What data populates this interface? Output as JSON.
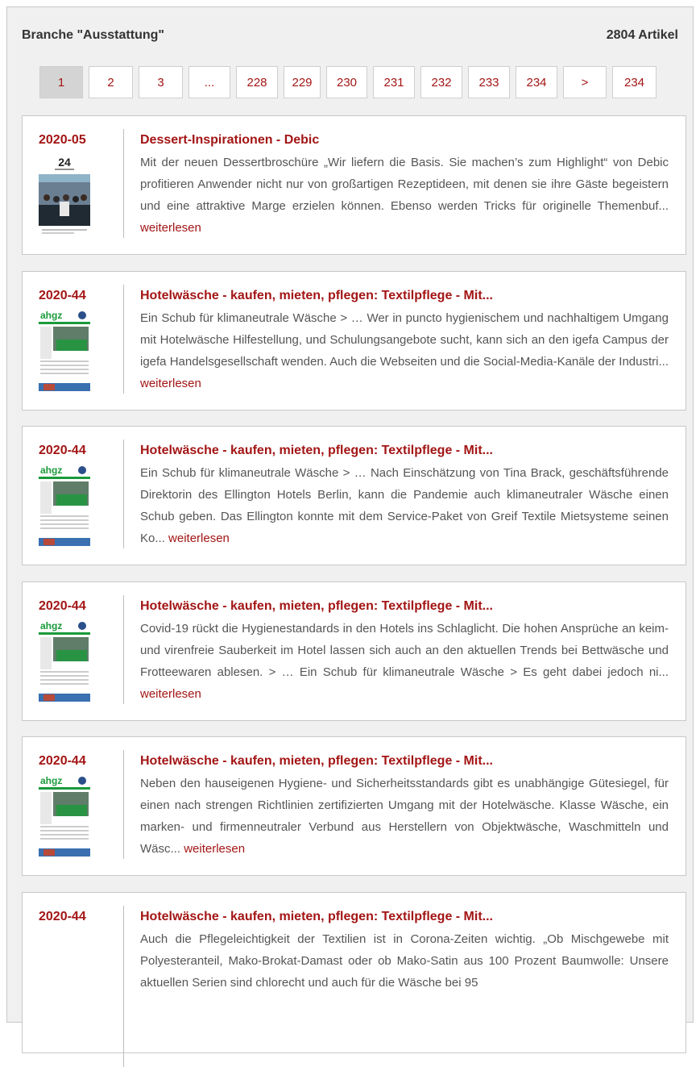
{
  "header": {
    "branche": "Branche \"Ausstattung\"",
    "count": "2804 Artikel"
  },
  "pagination": [
    {
      "label": "1",
      "active": true
    },
    {
      "label": "2"
    },
    {
      "label": "3"
    },
    {
      "label": "..."
    },
    {
      "label": "228"
    },
    {
      "label": "229"
    },
    {
      "label": "230"
    },
    {
      "label": "231"
    },
    {
      "label": "232"
    },
    {
      "label": "233"
    },
    {
      "label": "234"
    },
    {
      "label": ">"
    },
    {
      "label": "234"
    }
  ],
  "articles": [
    {
      "date": "2020-05",
      "thumb": "24",
      "title": "Dessert-Inspirationen - Debic",
      "text": "Mit der neuen Dessertbroschüre „Wir liefern die Basis. Sie machen’s zum Highlight“ von Debic profitieren Anwender nicht nur von großartigen Rezeptideen, mit denen sie ihre Gäste begeistern und eine attraktive Marge erzielen können. Ebenso werden Tricks für originelle Themenbuf...",
      "more": "weiterlesen"
    },
    {
      "date": "2020-44",
      "thumb": "ahgz",
      "title": "Hotelwäsche - kaufen, mieten, pflegen: Textilpflege - Mit...",
      "text": "Ein Schub für klimaneutrale Wäsche > … Wer in puncto hygienischem und nachhaltigem Umgang mit Hotelwäsche Hilfestellung, und Schulungsangebote sucht, kann sich an den igefa Campus der igefa Handelsgesellschaft wenden. Auch die Webseiten und die Social-Media-Kanäle der Industri...",
      "more": "weiterlesen"
    },
    {
      "date": "2020-44",
      "thumb": "ahgz",
      "title": "Hotelwäsche - kaufen, mieten, pflegen: Textilpflege - Mit...",
      "text": "Ein Schub für klimaneutrale Wäsche > … Nach Einschätzung von Tina Brack, geschäftsführende Direktorin des Ellington Hotels Berlin, kann die Pandemie auch klimaneutraler Wäsche einen Schub geben. Das Ellington konnte mit dem Service-Paket von Greif Textile Mietsysteme seinen Ko...",
      "more": "weiterlesen"
    },
    {
      "date": "2020-44",
      "thumb": "ahgz",
      "title": "Hotelwäsche - kaufen, mieten, pflegen: Textilpflege - Mit...",
      "text": "Covid-19 rückt die Hygienestandards in den Hotels ins Schlaglicht. Die hohen Ansprüche an keim- und virenfreie Sauberkeit im Hotel lassen sich auch an den aktuellen Trends bei Bettwäsche und Frotteewaren ablesen. > … Ein Schub für klimaneutrale Wäsche > Es geht dabei jedoch ni...",
      "more": "weiterlesen"
    },
    {
      "date": "2020-44",
      "thumb": "ahgz",
      "title": "Hotelwäsche - kaufen, mieten, pflegen: Textilpflege - Mit...",
      "text": "Neben den hauseigenen Hygiene- und Sicherheitsstandards gibt es unabhängige Gütesiegel, für einen nach strengen Richtlinien zertifizierten Umgang mit der Hotelwäsche. Klasse Wäsche, ein marken- und firmenneutraler Verbund aus Herstellern von Objektwäsche, Waschmitteln und Wäsc...",
      "more": "weiterlesen"
    },
    {
      "date": "2020-44",
      "thumb": "",
      "title": "Hotelwäsche - kaufen, mieten, pflegen: Textilpflege - Mit...",
      "text": "Auch die Pflegeleichtigkeit der Textilien ist in Corona-Zeiten wichtig. „Ob Mischgewebe mit Polyesteranteil, Mako-Brokat-Damast oder ob Mako-Satin aus 100 Prozent Baumwolle: Unsere aktuellen Serien sind chlorecht und auch für die Wäsche bei 95",
      "more": ""
    }
  ],
  "colors": {
    "accent": "#a31515",
    "bg": "#f0f0f0"
  }
}
